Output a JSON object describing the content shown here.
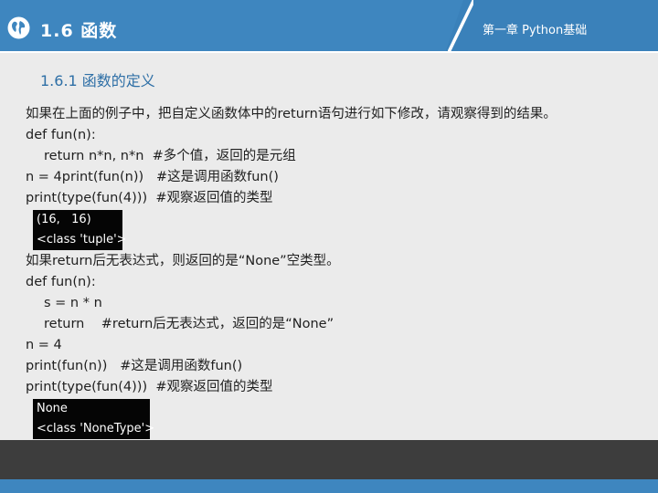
{
  "header": {
    "section_title": "1.6  函数",
    "chapter_title": "第一章 Python基础",
    "icon": "globe-icon",
    "color": "#3e86bf"
  },
  "subsection_title": "1.6.1  函数的定义",
  "block1": {
    "intro": "如果在上面的例子中，把自定义函数体中的return语句进行如下修改，请观察得到的结果。",
    "lines": [
      "def fun(n):",
      "return n*n, n*n  #多个值，返回的是元组",
      "n = 4print(fun(n))   #这是调用函数fun()",
      "print(type(fun(4)))  #观察返回值的类型"
    ],
    "output": [
      "(16,   16)",
      "<class 'tuple'>"
    ]
  },
  "block2": {
    "intro": "如果return后无表达式，则返回的是“None”空类型。",
    "lines": [
      "def fun(n):",
      "s = n * n",
      "return    #return后无表达式，返回的是“None”",
      "n = 4",
      "print(fun(n))   #这是调用函数fun()",
      "print(type(fun(4)))  #观察返回值的类型"
    ],
    "output": [
      "None",
      "<class 'NoneType'>"
    ]
  },
  "colors": {
    "footer_dark": "#3d3d3d",
    "footer_blue": "#3e86bf",
    "subsection": "#2e6fa6"
  }
}
